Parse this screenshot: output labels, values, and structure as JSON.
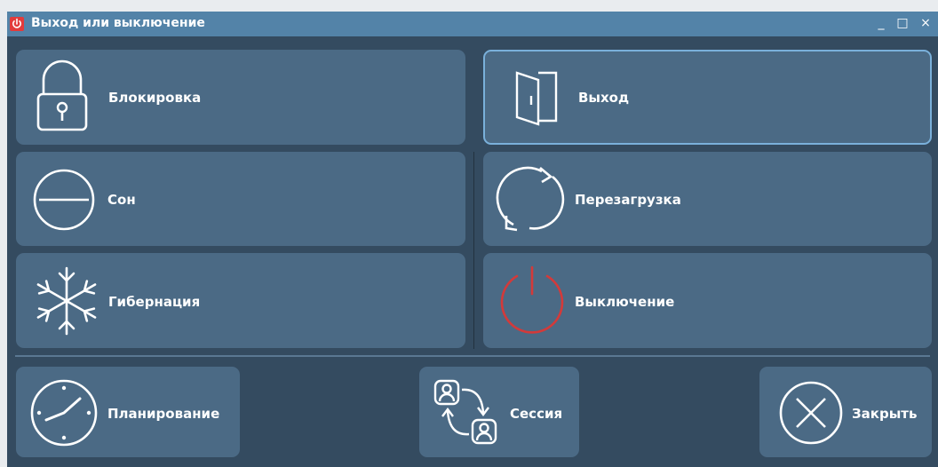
{
  "window": {
    "title": "Выход или выключение",
    "controls": {
      "minimize": "_",
      "maximize": "□",
      "close": "×"
    }
  },
  "actions": {
    "lock": {
      "label": "Блокировка",
      "icon": "lock-icon"
    },
    "logout": {
      "label": "Выход",
      "icon": "door-exit-icon"
    },
    "sleep": {
      "label": "Сон",
      "icon": "sleep-circle-icon"
    },
    "reboot": {
      "label": "Перезагрузка",
      "icon": "reboot-arrows-icon"
    },
    "hibernate": {
      "label": "Гибернация",
      "icon": "snowflake-icon"
    },
    "shutdown": {
      "label": "Выключение",
      "icon": "power-icon",
      "accent": "#d33a3a"
    },
    "schedule": {
      "label": "Планирование",
      "icon": "clock-icon"
    },
    "session": {
      "label": "Сессия",
      "icon": "switch-user-icon"
    },
    "close": {
      "label": "Закрыть",
      "icon": "close-circle-icon"
    }
  },
  "colors": {
    "window_bg": "#344b60",
    "titlebar": "#5383a8",
    "tile": "#4b6a85",
    "focus_border": "#7ab0da",
    "title_power_icon": "#e23b3b"
  }
}
